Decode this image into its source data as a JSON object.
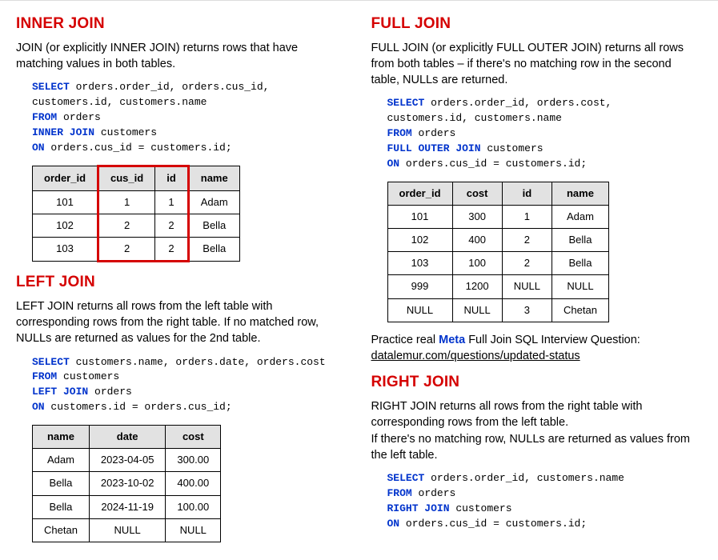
{
  "inner": {
    "title": "INNER JOIN",
    "desc": "JOIN (or explicitly INNER JOIN) returns rows that have matching values in both tables.",
    "code_lines": [
      {
        "kw": "SELECT",
        "rest": " orders.order_id, orders.cus_id,"
      },
      {
        "kw": "",
        "rest": "customers.id, customers.name"
      },
      {
        "kw": "FROM",
        "rest": " orders"
      },
      {
        "kw": "INNER JOIN",
        "rest": " customers"
      },
      {
        "kw": "ON",
        "rest": " orders.cus_id = customers.id;"
      }
    ],
    "headers": [
      "order_id",
      "cus_id",
      "id",
      "name"
    ],
    "rows": [
      [
        "101",
        "1",
        "1",
        "Adam"
      ],
      [
        "102",
        "2",
        "2",
        "Bella"
      ],
      [
        "103",
        "2",
        "2",
        "Bella"
      ]
    ]
  },
  "left": {
    "title": "LEFT JOIN",
    "desc": "LEFT JOIN returns all rows from the left table with corresponding rows from the right table. If no matched row, NULLs are returned as values for the 2nd table.",
    "code_lines": [
      {
        "kw": "SELECT",
        "rest": " customers.name, orders.date, orders.cost"
      },
      {
        "kw": "FROM",
        "rest": " customers"
      },
      {
        "kw": "LEFT JOIN",
        "rest": " orders"
      },
      {
        "kw": "ON",
        "rest": " customers.id = orders.cus_id;"
      }
    ],
    "headers": [
      "name",
      "date",
      "cost"
    ],
    "rows": [
      [
        "Adam",
        "2023-04-05",
        "300.00"
      ],
      [
        "Bella",
        "2023-10-02",
        "400.00"
      ],
      [
        "Bella",
        "2024-11-19",
        "100.00"
      ],
      [
        "Chetan",
        "NULL",
        "NULL"
      ]
    ]
  },
  "full": {
    "title": "FULL JOIN",
    "desc": "FULL JOIN  (or explicitly FULL OUTER JOIN) returns all rows from both tables – if there's no matching row in the second table,  NULLs are returned.",
    "code_lines": [
      {
        "kw": "SELECT",
        "rest": " orders.order_id, orders.cost,"
      },
      {
        "kw": "",
        "rest": "customers.id, customers.name"
      },
      {
        "kw": "FROM",
        "rest": " orders"
      },
      {
        "kw": "FULL OUTER JOIN",
        "rest": " customers"
      },
      {
        "kw": "ON",
        "rest": " orders.cus_id = customers.id;"
      }
    ],
    "headers": [
      "order_id",
      "cost",
      "id",
      "name"
    ],
    "rows": [
      [
        "101",
        "300",
        "1",
        "Adam"
      ],
      [
        "102",
        "400",
        "2",
        "Bella"
      ],
      [
        "103",
        "100",
        "2",
        "Bella"
      ],
      [
        "999",
        "1200",
        "NULL",
        "NULL"
      ],
      [
        "NULL",
        "NULL",
        "3",
        "Chetan"
      ]
    ],
    "practice_prefix": "Practice real ",
    "practice_brand": "Meta",
    "practice_suffix": " Full Join SQL Interview Question:",
    "practice_link": "datalemur.com/questions/updated-status"
  },
  "right": {
    "title": "RIGHT JOIN",
    "desc": "RIGHT JOIN returns all rows from the right table with corresponding rows from the left table.\nIf there's no matching row, NULLs are returned as values from the left table.",
    "code_lines": [
      {
        "kw": "SELECT",
        "rest": " orders.order_id, customers.name"
      },
      {
        "kw": "FROM",
        "rest": " orders"
      },
      {
        "kw": "RIGHT JOIN",
        "rest": " customers"
      },
      {
        "kw": "ON",
        "rest": " orders.cus_id = customers.id;"
      }
    ]
  }
}
